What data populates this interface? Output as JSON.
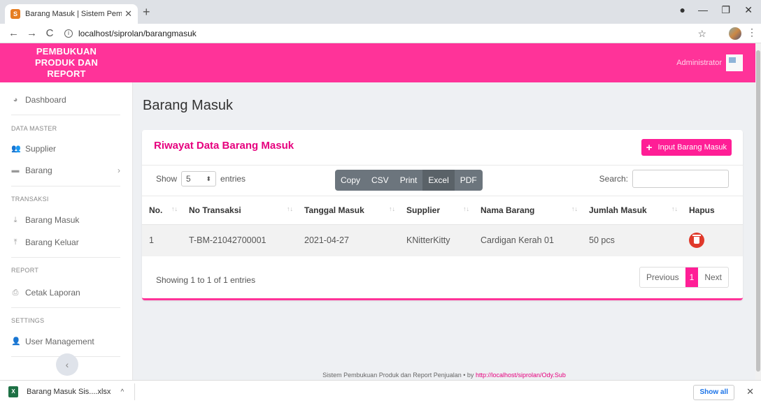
{
  "browser": {
    "tab_title": "Barang Masuk | Sistem Pembuku",
    "new_tab": "+",
    "url": "localhost/siprolan/barangmasuk"
  },
  "header": {
    "brand_line1": "PEMBUKUAN",
    "brand_line2": "PRODUK DAN",
    "brand_line3": "REPORT",
    "user": "Administrator",
    "accent": "#ff3399"
  },
  "sidebar": {
    "dashboard": "Dashboard",
    "data_master": "DATA MASTER",
    "supplier": "Supplier",
    "barang": "Barang",
    "transaksi": "TRANSAKSI",
    "barang_masuk": "Barang Masuk",
    "barang_keluar": "Barang Keluar",
    "report": "REPORT",
    "cetak_laporan": "Cetak Laporan",
    "settings": "SETTINGS",
    "user_management": "User Management"
  },
  "main": {
    "page_title": "Barang Masuk",
    "card_title": "Riwayat Data Barang Masuk",
    "input_button": "Input Barang Masuk",
    "show_label": "Show",
    "entries_value": "5",
    "entries_label": "entries",
    "export": {
      "copy": "Copy",
      "csv": "CSV",
      "print": "Print",
      "excel": "Excel",
      "pdf": "PDF"
    },
    "search_label": "Search:",
    "columns": {
      "no": "No.",
      "no_transaksi": "No Transaksi",
      "tanggal": "Tanggal Masuk",
      "supplier": "Supplier",
      "nama_barang": "Nama Barang",
      "jumlah": "Jumlah Masuk",
      "hapus": "Hapus"
    },
    "rows": [
      {
        "no": "1",
        "no_transaksi": "T-BM-21042700001",
        "tanggal": "2021-04-27",
        "supplier": "KNitterKitty",
        "nama_barang": "Cardigan Kerah 01",
        "jumlah": "50 pcs"
      }
    ],
    "info": "Showing 1 to 1 of 1 entries",
    "pager": {
      "previous": "Previous",
      "page": "1",
      "next": "Next"
    }
  },
  "footer": {
    "text": "Sistem Pembukuan Produk dan Report Penjualan • by ",
    "link": "http://localhost/siprolan/Ody.Sub"
  },
  "downloads": {
    "file": "Barang Masuk Sis....xlsx",
    "show_all": "Show all"
  }
}
